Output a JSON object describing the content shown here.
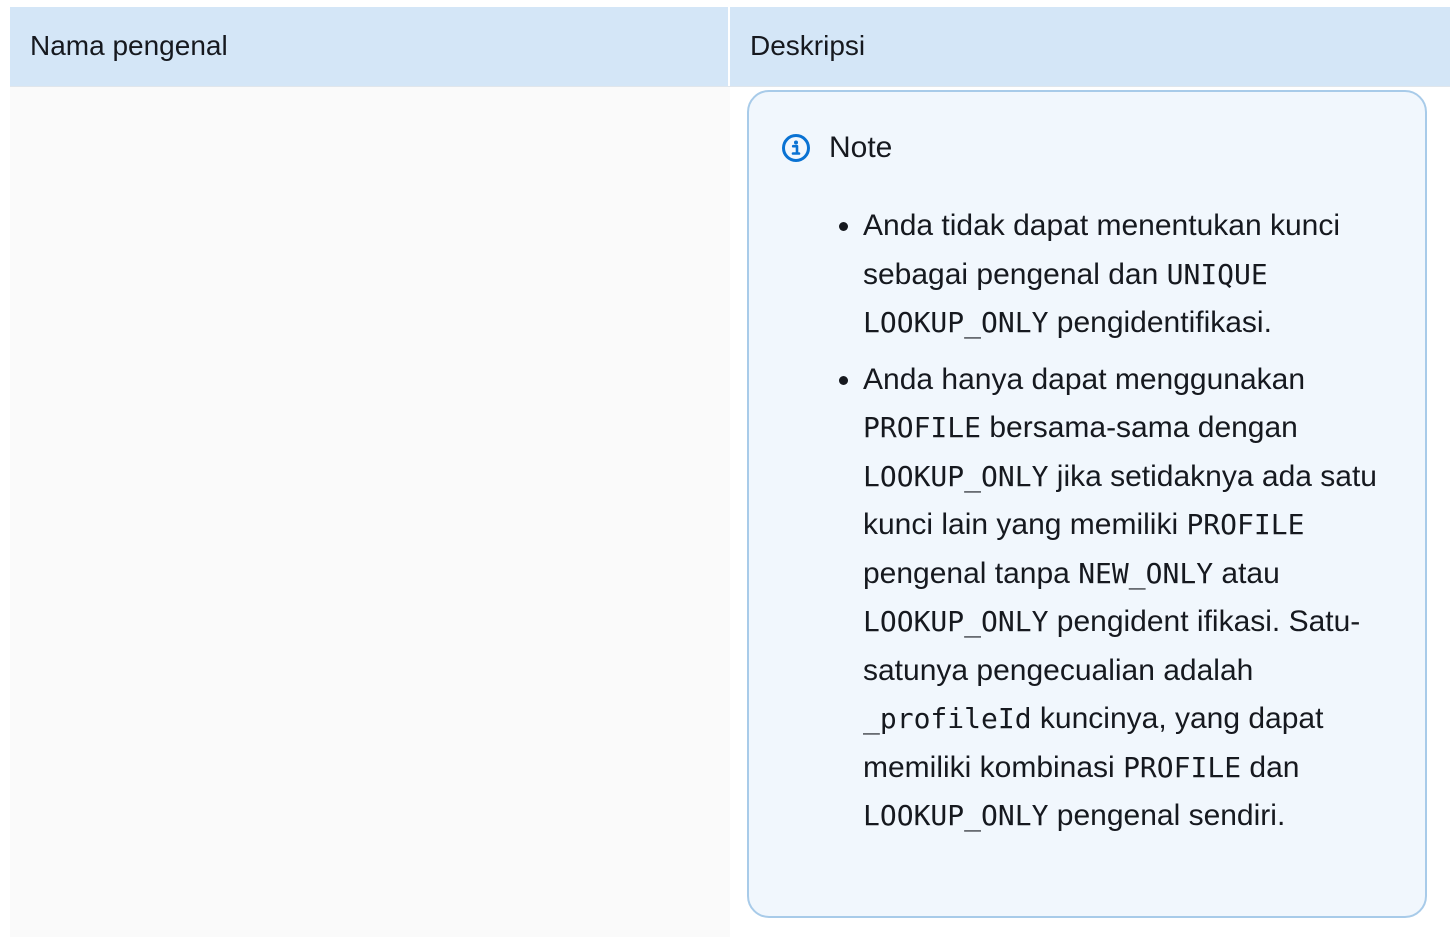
{
  "table": {
    "headers": [
      "Nama pengenal",
      "Deskripsi"
    ]
  },
  "note": {
    "icon": "info-icon",
    "title": "Note",
    "bullet1": {
      "t1": "Anda tidak dapat menentukan kunci sebagai pengenal dan ",
      "c1": "UNIQUE",
      "c2": "LOOKUP_ONLY",
      "t2": " pengidentifikasi."
    },
    "bullet2": {
      "t1": "Anda hanya dapat menggunakan ",
      "c1": "PROFILE",
      "t2": " bersama-sama dengan ",
      "c2": "LOOKUP_ONLY",
      "t3": " jika setidaknya ada satu kunci lain yang memiliki ",
      "c3": "PROFILE",
      "t4": " pengenal tanpa ",
      "c4": "NEW_ONLY",
      "t5": " atau ",
      "c5": "LOOKUP_ONLY",
      "t6": " pengident ifikasi. Satu-satunya pengecualian adalah ",
      "c6": "_profileId",
      "t7": " kuncinya, yang dapat memiliki kombinasi ",
      "c7": "PROFILE",
      "t8": " dan ",
      "c8": "LOOKUP_ONLY",
      "t9": " pengenal sendiri."
    }
  }
}
